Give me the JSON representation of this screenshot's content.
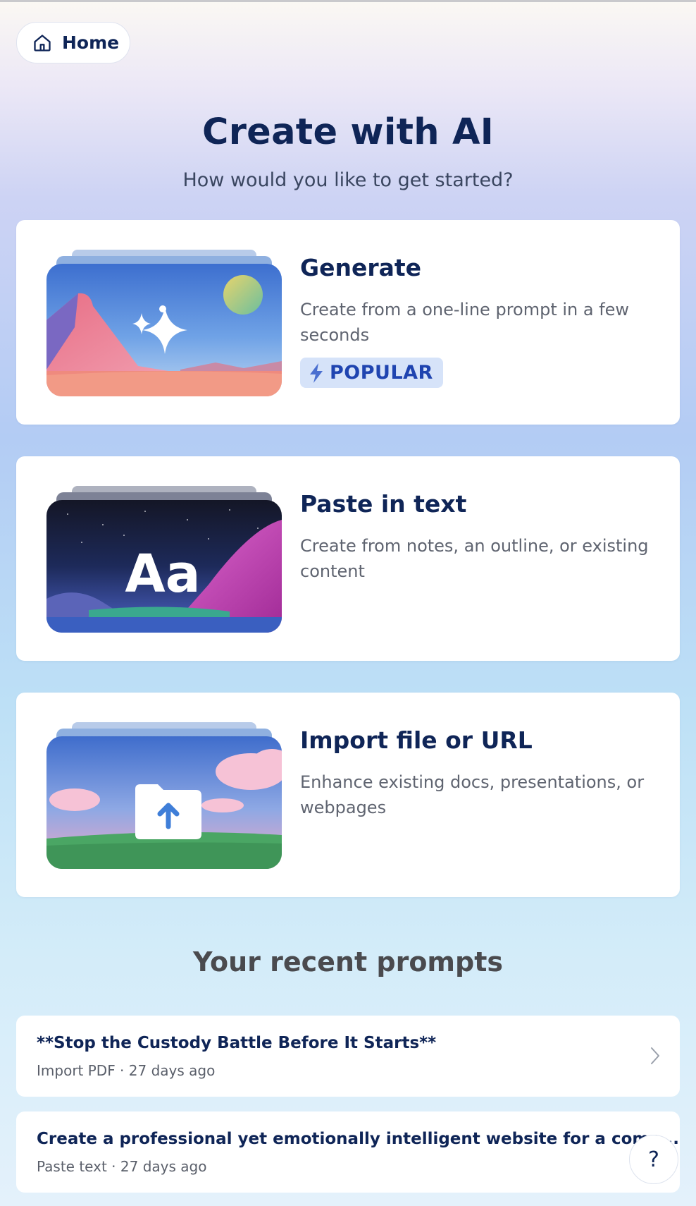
{
  "nav": {
    "home_label": "Home"
  },
  "header": {
    "title": "Create with AI",
    "subtitle": "How would you like to get started?"
  },
  "cards": [
    {
      "title": "Generate",
      "description": "Create from a one-line prompt in a few seconds",
      "badge": "POPULAR",
      "badge_color": "#1f44b0"
    },
    {
      "title": "Paste in text",
      "description": "Create from notes, an outline, or existing content",
      "thumb_text": "Aa"
    },
    {
      "title": "Import file or URL",
      "description": "Enhance existing docs, presentations, or webpages"
    }
  ],
  "recent": {
    "heading": "Your recent prompts",
    "items": [
      {
        "title": "**Stop the Custody Battle Before It Starts**",
        "meta": "Import PDF · 27 days ago"
      },
      {
        "title": "Create a professional yet emotionally intelligent website for a comp...",
        "meta": "Paste text · 27 days ago"
      }
    ]
  },
  "help": {
    "label": "?"
  },
  "icons": [
    "home-icon",
    "sparkle-icon",
    "lightning-icon",
    "folder-upload-icon",
    "chevron-right-icon"
  ]
}
